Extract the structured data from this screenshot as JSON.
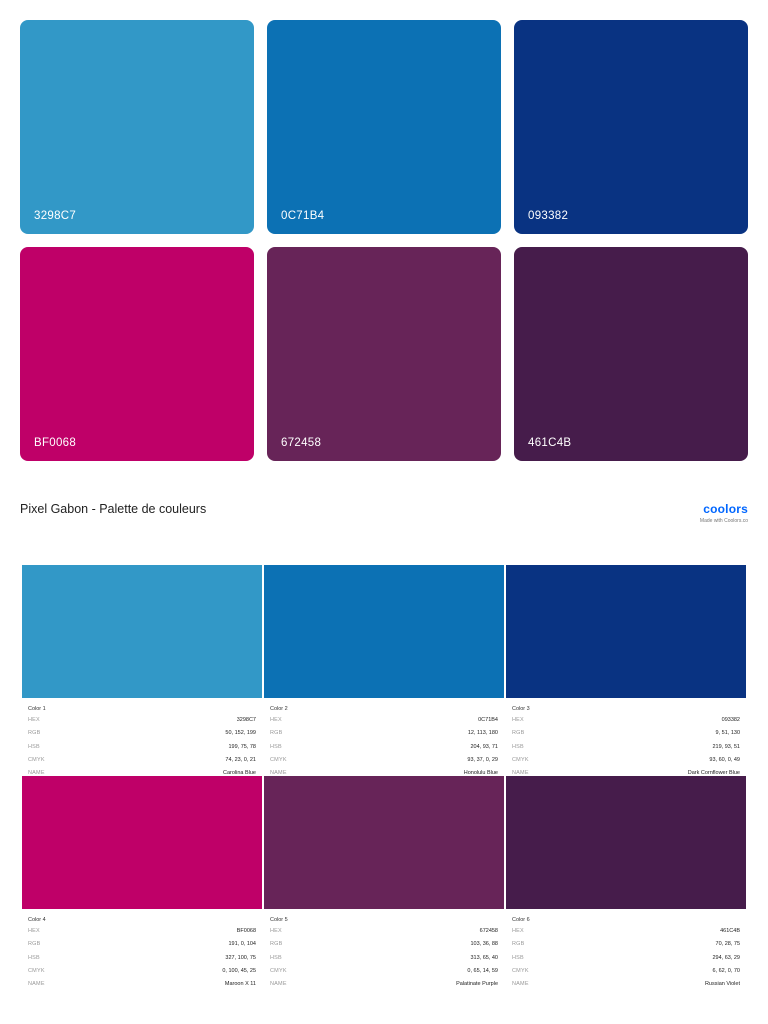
{
  "swatches": [
    {
      "hex": "3298C7",
      "color": "#3298C7"
    },
    {
      "hex": "0C71B4",
      "color": "#0C71B4"
    },
    {
      "hex": "093382",
      "color": "#093382"
    },
    {
      "hex": "BF0068",
      "color": "#BF0068"
    },
    {
      "hex": "672458",
      "color": "#672458"
    },
    {
      "hex": "461C4B",
      "color": "#461C4B"
    }
  ],
  "palette_title": "Pixel Gabon - Palette de couleurs",
  "brand": {
    "logo": "coolors",
    "tagline": "Made with Coolors.co"
  },
  "labels": {
    "hex": "HEX",
    "rgb": "RGB",
    "hsb": "HSB",
    "cmyk": "CMYK",
    "name": "NAME"
  },
  "colors": [
    {
      "title": "Color 1",
      "color": "#3298C7",
      "hex": "3298C7",
      "rgb": "50, 152, 199",
      "hsb": "199, 75, 78",
      "cmyk": "74, 23, 0, 21",
      "name": "Carolina Blue"
    },
    {
      "title": "Color 2",
      "color": "#0C71B4",
      "hex": "0C71B4",
      "rgb": "12, 113, 180",
      "hsb": "204, 93, 71",
      "cmyk": "93, 37, 0, 29",
      "name": "Honolulu Blue"
    },
    {
      "title": "Color 3",
      "color": "#093382",
      "hex": "093382",
      "rgb": "9, 51, 130",
      "hsb": "219, 93, 51",
      "cmyk": "93, 60, 0, 49",
      "name": "Dark Cornflower Blue"
    },
    {
      "title": "Color 4",
      "color": "#BF0068",
      "hex": "BF0068",
      "rgb": "191, 0, 104",
      "hsb": "327, 100, 75",
      "cmyk": "0, 100, 45, 25",
      "name": "Maroon X 11"
    },
    {
      "title": "Color 5",
      "color": "#672458",
      "hex": "672458",
      "rgb": "103, 36, 88",
      "hsb": "313, 65, 40",
      "cmyk": "0, 65, 14, 59",
      "name": "Palatinate Purple"
    },
    {
      "title": "Color 6",
      "color": "#461C4B",
      "hex": "461C4B",
      "rgb": "70, 28, 75",
      "hsb": "294, 63, 29",
      "cmyk": "6, 62, 0, 70",
      "name": "Russian Violet"
    }
  ]
}
